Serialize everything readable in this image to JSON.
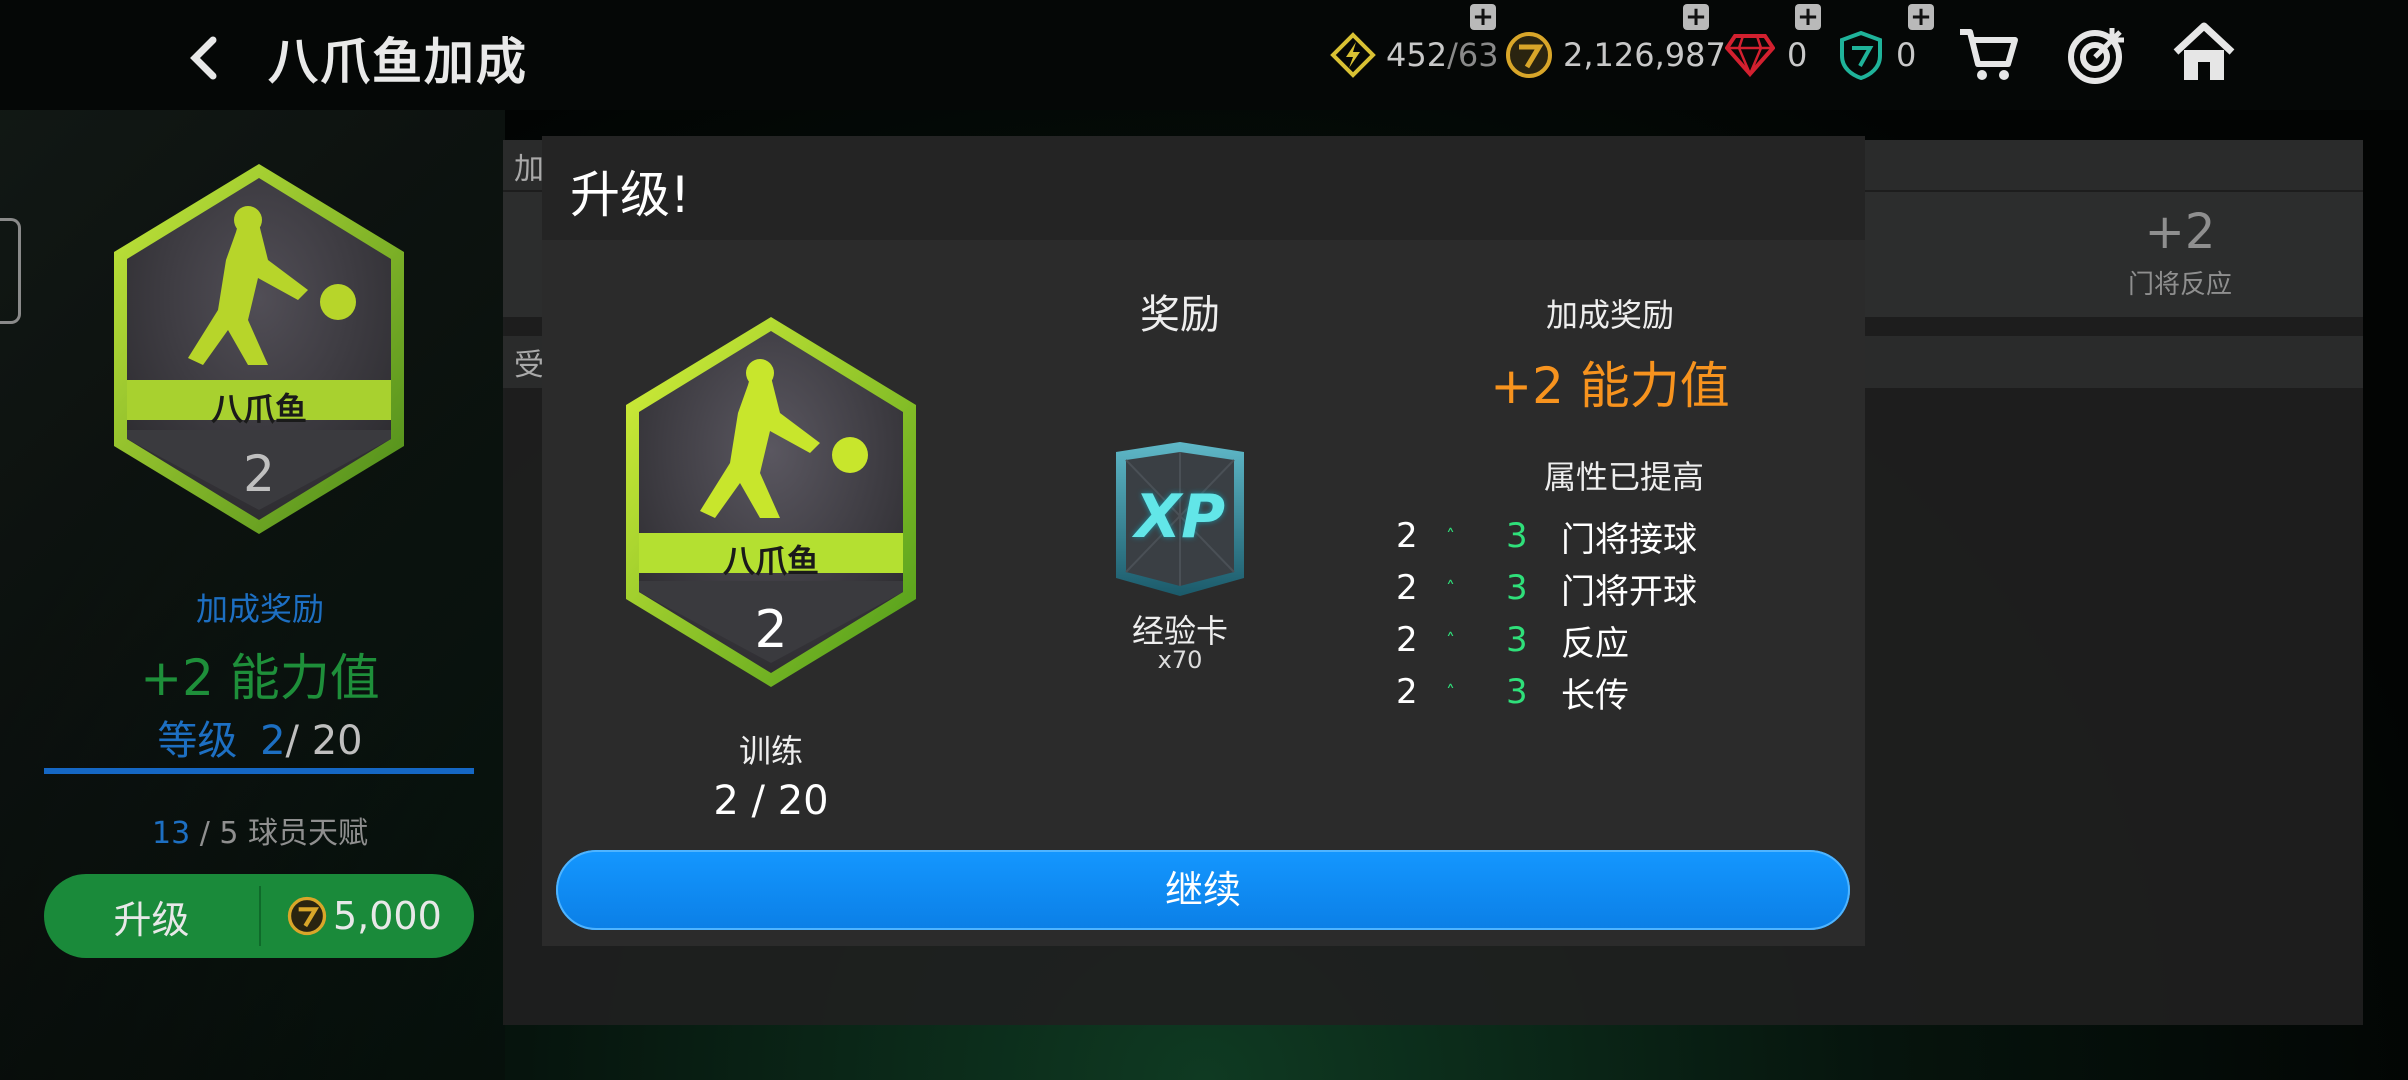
{
  "header": {
    "title": "八爪鱼加成",
    "currencies": {
      "energy": {
        "value": "452",
        "max": "/63"
      },
      "coins": {
        "value": "2,126,987"
      },
      "gems": {
        "value": "0"
      },
      "tokens": {
        "value": "0"
      }
    }
  },
  "left_panel": {
    "badge_name": "八爪鱼",
    "badge_level": "2",
    "bonus_label": "加成奖励",
    "bonus_value": "+2 能力值",
    "level_label": "等级",
    "level_current": "2",
    "level_max": "/ 20",
    "talent_current": "13",
    "talent_text": "/ 5 球员天赋",
    "upgrade_label": "升级",
    "upgrade_cost": "5,000"
  },
  "background_panel": {
    "header_fragment": "加",
    "row_fragment": "受",
    "stat_value": "+2",
    "stat_label": "门将反应"
  },
  "modal": {
    "title": "升级!",
    "badge_name": "八爪鱼",
    "badge_level": "2",
    "training_label": "训练",
    "training_progress": "2 / 20",
    "reward_title": "奖励",
    "reward_card_text": "XP",
    "reward_name": "经验卡",
    "reward_qty": "x70",
    "bonus_title": "加成奖励",
    "bonus_value": "+2 能力值",
    "attributes_title": "属性已提高",
    "attributes": [
      {
        "old": "2",
        "new": "3",
        "name": "门将接球"
      },
      {
        "old": "2",
        "new": "3",
        "name": "门将开球"
      },
      {
        "old": "2",
        "new": "3",
        "name": "反应"
      },
      {
        "old": "2",
        "new": "3",
        "name": "长传"
      }
    ],
    "continue_label": "继续"
  },
  "colors": {
    "accent_blue": "#1497ff",
    "bonus_orange": "#f7931e",
    "green_up": "#2fe07a",
    "badge_green": "#9bd62a"
  }
}
